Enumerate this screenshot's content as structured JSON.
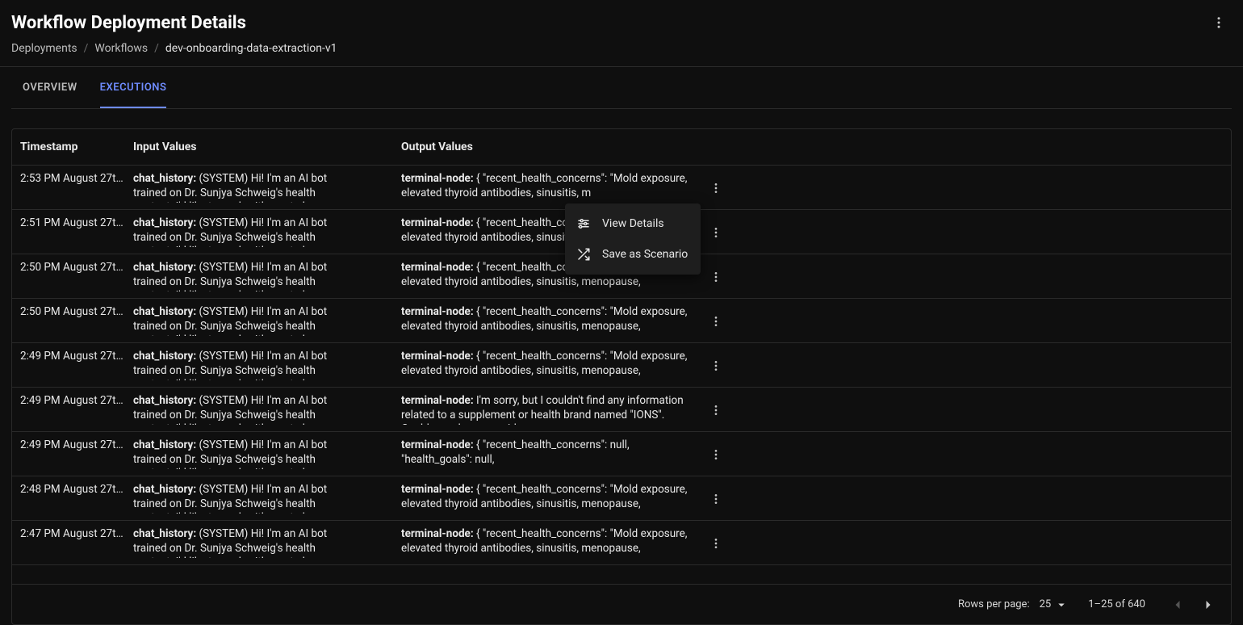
{
  "header": {
    "title": "Workflow Deployment Details"
  },
  "breadcrumbs": {
    "items": [
      "Deployments",
      "Workflows",
      "dev-onboarding-data-extraction-v1"
    ]
  },
  "tabs": {
    "overview": "OVERVIEW",
    "executions": "EXECUTIONS"
  },
  "table": {
    "columns": {
      "timestamp": "Timestamp",
      "input": "Input Values",
      "output": "Output Values"
    },
    "rows": [
      {
        "timestamp": "2:53 PM August 27th…",
        "input_label": "chat_history:",
        "input_body": "(SYSTEM) Hi! I'm an AI bot trained on Dr. Sunjya Schweig's health content. I'd like to work with you to learn about your health history",
        "output_label": "terminal-node:",
        "output_body": "{ \"recent_health_concerns\": \"Mold exposure, elevated thyroid antibodies, sinusitis, m"
      },
      {
        "timestamp": "2:51 PM August 27th…",
        "input_label": "chat_history:",
        "input_body": "(SYSTEM) Hi! I'm an AI bot trained on Dr. Sunjya Schweig's health content. I'd like to work with you to learn about your health history",
        "output_label": "terminal-node:",
        "output_body": "{ \"recent_health_concerns\": \"Mold expos elevated thyroid antibodies, sinusitis, m"
      },
      {
        "timestamp": "2:50 PM August 27th…",
        "input_label": "chat_history:",
        "input_body": "(SYSTEM) Hi! I'm an AI bot trained on Dr. Sunjya Schweig's health content. I'd like to work with you to learn about your health history",
        "output_label": "terminal-node:",
        "output_body": "{ \"recent_health_concerns\": \"Mold exposure, elevated thyroid antibodies, sinusitis, menopause,"
      },
      {
        "timestamp": "2:50 PM August 27th…",
        "input_label": "chat_history:",
        "input_body": "(SYSTEM) Hi! I'm an AI bot trained on Dr. Sunjya Schweig's health content. I'd like to work with you to learn about your health history",
        "output_label": "terminal-node:",
        "output_body": "{ \"recent_health_concerns\": \"Mold exposure, elevated thyroid antibodies, sinusitis, menopause,"
      },
      {
        "timestamp": "2:49 PM August 27th…",
        "input_label": "chat_history:",
        "input_body": "(SYSTEM) Hi! I'm an AI bot trained on Dr. Sunjya Schweig's health content. I'd like to work with you to learn about your health history",
        "output_label": "terminal-node:",
        "output_body": "{ \"recent_health_concerns\": \"Mold exposure, elevated thyroid antibodies, sinusitis, menopause,"
      },
      {
        "timestamp": "2:49 PM August 27th…",
        "input_label": "chat_history:",
        "input_body": "(SYSTEM) Hi! I'm an AI bot trained on Dr. Sunjya Schweig's health content. I'd like to work with you to learn about your health history",
        "output_label": "terminal-node:",
        "output_body": "I'm sorry, but I couldn't find any information related to a supplement or health brand named \"IONS\". Could you please provide"
      },
      {
        "timestamp": "2:49 PM August 27th…",
        "input_label": "chat_history:",
        "input_body": "(SYSTEM) Hi! I'm an AI bot trained on Dr. Sunjya Schweig's health content. I'd like to work with you to learn about your health history",
        "output_label": "terminal-node:",
        "output_body": "{ \"recent_health_concerns\": null, \"health_goals\": null,"
      },
      {
        "timestamp": "2:48 PM August 27th…",
        "input_label": "chat_history:",
        "input_body": "(SYSTEM) Hi! I'm an AI bot trained on Dr. Sunjya Schweig's health content. I'd like to work with you to learn about your health history",
        "output_label": "terminal-node:",
        "output_body": "{ \"recent_health_concerns\": \"Mold exposure, elevated thyroid antibodies, sinusitis, menopause,"
      },
      {
        "timestamp": "2:47 PM August 27th…",
        "input_label": "chat_history:",
        "input_body": "(SYSTEM) Hi! I'm an AI bot trained on Dr. Sunjya Schweig's health content. I'd like to work with you to learn about your health history",
        "output_label": "terminal-node:",
        "output_body": "{ \"recent_health_concerns\": \"Mold exposure, elevated thyroid antibodies, sinusitis, menopause,"
      }
    ]
  },
  "menu": {
    "view_details": "View Details",
    "save_scenario": "Save as Scenario"
  },
  "footer": {
    "rows_per_page_label": "Rows per page:",
    "rows_per_page_value": "25",
    "range": "1–25 of 640"
  }
}
